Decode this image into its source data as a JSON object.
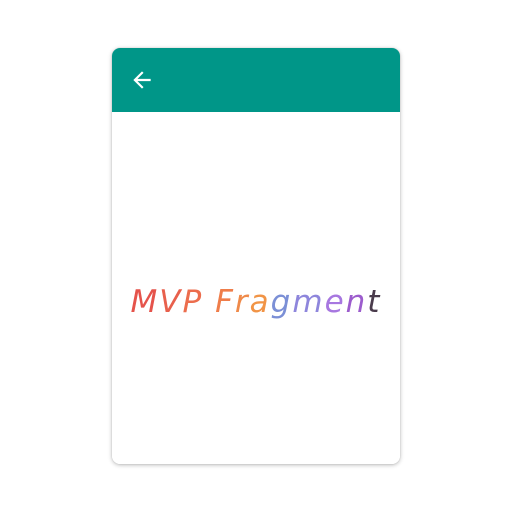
{
  "toolbar": {
    "back_icon": "arrow-back-icon",
    "background_color": "#009688",
    "icon_color": "#ffffff"
  },
  "content": {
    "title": "MVP Fragment",
    "letter_colors": [
      "#e5534b",
      "#e8604c",
      "#ec6d4d",
      "transparent",
      "#ef7d4a",
      "#ef8a4a",
      "#f19446",
      "#7b8fd6",
      "#8e86dc",
      "#a777e0",
      "#9c5ccd",
      "#4a3b4c"
    ]
  }
}
